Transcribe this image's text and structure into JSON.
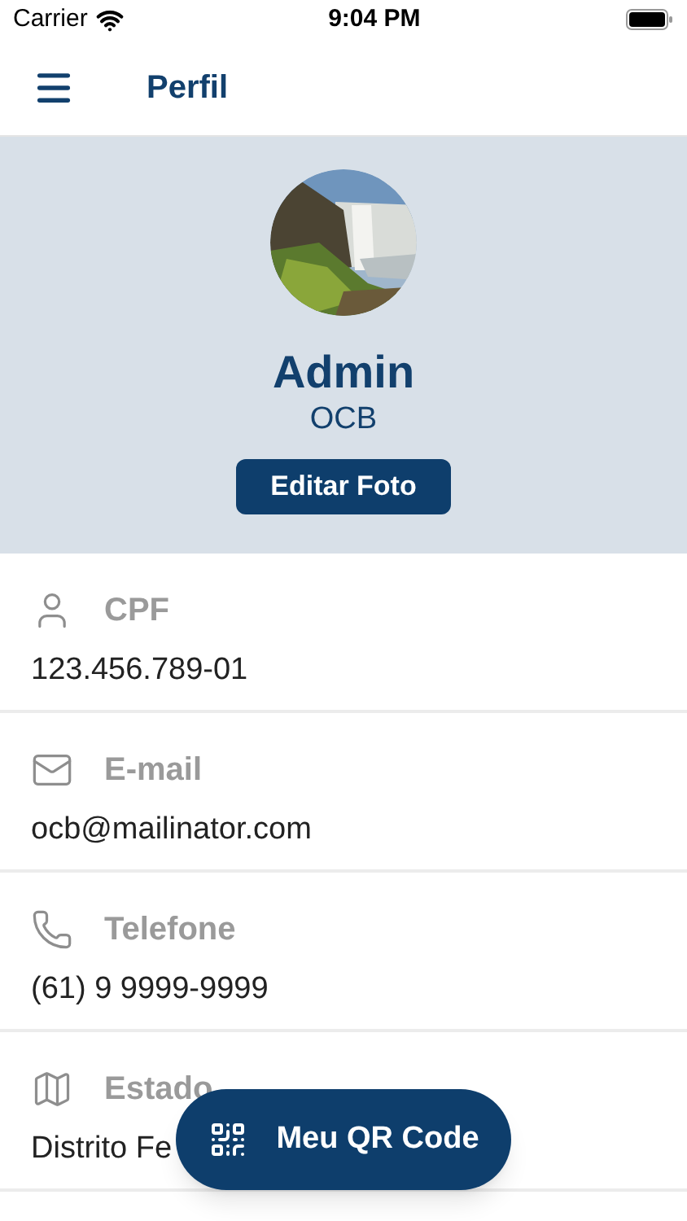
{
  "status_bar": {
    "carrier": "Carrier",
    "time": "9:04 PM"
  },
  "nav": {
    "title": "Perfil"
  },
  "profile": {
    "name": "Admin",
    "organization": "OCB",
    "edit_button": "Editar Foto"
  },
  "fields": [
    {
      "kind": "person",
      "label": "CPF",
      "value": "123.456.789-01"
    },
    {
      "kind": "mail",
      "label": "E-mail",
      "value": "ocb@mailinator.com"
    },
    {
      "kind": "phone",
      "label": "Telefone",
      "value": "(61) 9 9999-9999"
    },
    {
      "kind": "map",
      "label": "Estado",
      "value": "Distrito Fe"
    }
  ],
  "fab": {
    "label": "Meu QR Code"
  }
}
